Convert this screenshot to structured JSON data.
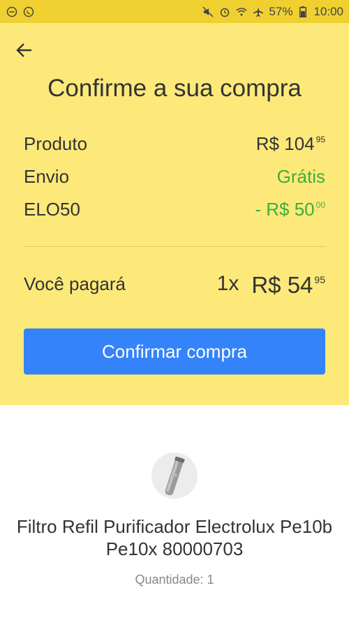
{
  "status_bar": {
    "battery_percent": "57%",
    "time": "10:00",
    "icons": [
      "minus-circle-icon",
      "whatsapp-icon",
      "mute-icon",
      "alarm-icon",
      "wifi-icon",
      "airplane-icon",
      "battery-icon"
    ]
  },
  "header": {
    "back_icon": "arrow-left-icon",
    "title": "Confirme a sua compra"
  },
  "summary": {
    "product": {
      "label": "Produto",
      "currency": "R$ ",
      "integer": "104",
      "cents": "95"
    },
    "shipping": {
      "label": "Envio",
      "value": "Grátis"
    },
    "coupon": {
      "label": "ELO50",
      "currency": "- R$ ",
      "integer": "50",
      "cents": "00"
    },
    "total": {
      "label": "Você pagará",
      "installments": "1x",
      "currency": "R$ ",
      "integer": "54",
      "cents": "95"
    }
  },
  "confirm_button": {
    "label": "Confirmar compra"
  },
  "product": {
    "title": "Filtro Refil Purificador Electrolux Pe10b Pe10x 80000703",
    "quantity": "Quantidade: 1"
  },
  "colors": {
    "status_bar": "#f0d030",
    "header_bg": "#fde97a",
    "accent_blue": "#3483fa",
    "discount_green": "#3fae3b"
  }
}
